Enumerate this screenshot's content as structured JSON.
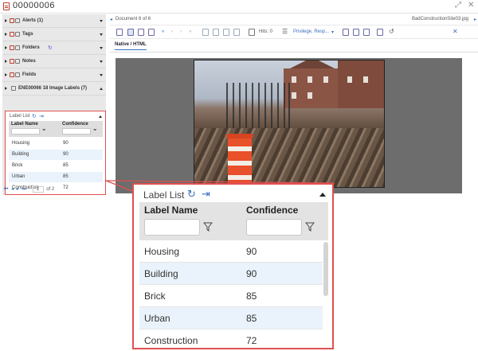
{
  "title_bar": {
    "title": "00000006"
  },
  "left_panel": {
    "sections": [
      {
        "label": "Alerts (1)",
        "icon": "alert-icon"
      },
      {
        "label": "Tags",
        "icon": "tag-icon"
      },
      {
        "label": "Folders",
        "icon": "folder-icon"
      },
      {
        "label": "Notes",
        "icon": "note-icon"
      },
      {
        "label": "Fields",
        "icon": "fields-icon"
      },
      {
        "label": "ENE00066 18 Image Labels (7)",
        "icon": "image-labels-icon"
      }
    ],
    "label_list": {
      "heading": "Label List",
      "columns": [
        "Label Name",
        "Confidence"
      ],
      "rows": [
        {
          "label": "Housing",
          "confidence": "90"
        },
        {
          "label": "Building",
          "confidence": "90"
        },
        {
          "label": "Brick",
          "confidence": "85"
        },
        {
          "label": "Urban",
          "confidence": "85"
        },
        {
          "label": "Construction",
          "confidence": "72"
        }
      ]
    },
    "pager": {
      "current": "1",
      "of_label": "of 2"
    }
  },
  "document": {
    "position": "Document 6 of 6",
    "filename": "BadConstructionSite03.jpg",
    "hits": "Hits: 0",
    "privilege_dropdown": "Privilege, Resp...",
    "tab": "Native / HTML"
  },
  "colors": {
    "accent": "#3a6fc1",
    "highlight": "#e05050",
    "alt_row": "#eaf3fb"
  }
}
